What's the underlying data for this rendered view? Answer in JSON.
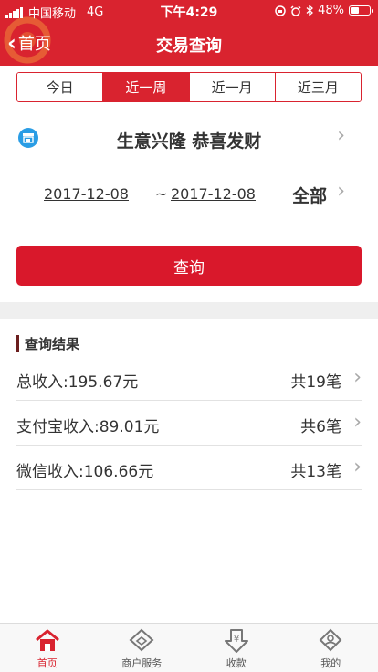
{
  "status_bar": {
    "carrier": "中国移动",
    "network": "4G",
    "time": "下午4:29",
    "battery": "48%",
    "battery_level": 0.48
  },
  "nav": {
    "back_label": "首页",
    "title": "交易查询"
  },
  "period_tabs": [
    {
      "label": "今日",
      "active": false
    },
    {
      "label": "近一周",
      "active": true
    },
    {
      "label": "近一月",
      "active": false
    },
    {
      "label": "近三月",
      "active": false
    }
  ],
  "merchant": {
    "name": "生意兴隆 恭喜发财",
    "icon": "store-icon"
  },
  "date_range": {
    "start": "2017-12-08",
    "separator": "~",
    "end": "2017-12-08",
    "filter": "全部"
  },
  "query_button": "查询",
  "results": {
    "title": "查询结果",
    "rows": [
      {
        "label": "总收入:195.67元",
        "count": "共19笔"
      },
      {
        "label": "支付宝收入:89.01元",
        "count": "共6笔"
      },
      {
        "label": "微信收入:106.66元",
        "count": "共13笔"
      }
    ]
  },
  "tabbar": [
    {
      "label": "首页",
      "icon": "home-icon",
      "active": true
    },
    {
      "label": "商户服务",
      "icon": "merchant-service-icon",
      "active": false
    },
    {
      "label": "收款",
      "icon": "receive-payment-icon",
      "active": false
    },
    {
      "label": "我的",
      "icon": "profile-icon",
      "active": false
    }
  ],
  "colors": {
    "accent": "#d9232f",
    "button": "#d9182b",
    "store_icon": "#2a9de5"
  }
}
